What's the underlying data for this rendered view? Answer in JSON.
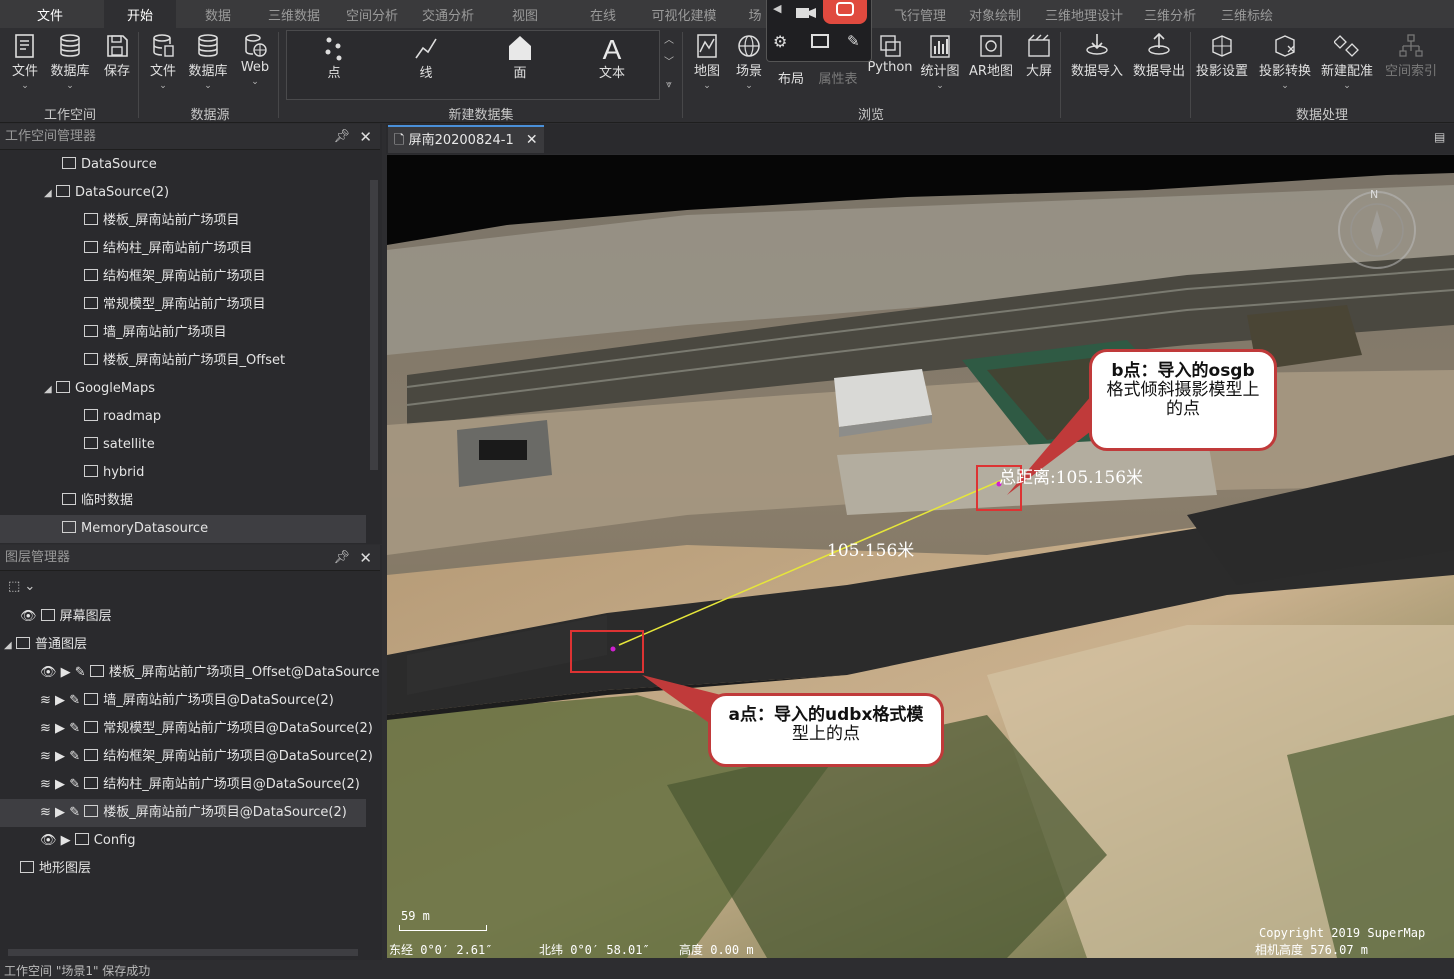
{
  "menu_tabs": [
    "文件",
    "开始",
    "数据",
    "三维数据",
    "空间分析",
    "交通分析",
    "视图",
    "在线",
    "可视化建模",
    "场",
    "飞行管理",
    "对象绘制",
    "三维地理设计",
    "三维分析",
    "三维标绘"
  ],
  "active_tab": "开始",
  "ribbon": {
    "workspace": {
      "group": "工作空间",
      "buttons": [
        "文件",
        "数据库",
        "保存"
      ]
    },
    "datasource": {
      "group": "数据源",
      "buttons": [
        "文件",
        "数据库",
        "Web"
      ]
    },
    "new_dataset": {
      "group": "新建数据集",
      "buttons": [
        "点",
        "线",
        "面",
        "文本"
      ]
    },
    "browse": {
      "group": "浏览",
      "buttons": [
        "地图",
        "场景",
        "布局",
        "属性表",
        "Python",
        "统计图",
        "AR地图",
        "大屏"
      ]
    },
    "data_processing": {
      "group": "数据处理",
      "buttons": [
        "数据导入",
        "数据导出",
        "投影设置",
        "投影转换",
        "新建配准",
        "空间索引"
      ]
    }
  },
  "workspace_panel": {
    "title": "工作空间管理器",
    "items": [
      {
        "label": "DataSource"
      },
      {
        "label": "DataSource(2)"
      },
      {
        "label": "楼板_屏南站前广场项目"
      },
      {
        "label": "结构柱_屏南站前广场项目"
      },
      {
        "label": "结构框架_屏南站前广场项目"
      },
      {
        "label": "常规模型_屏南站前广场项目"
      },
      {
        "label": "墙_屏南站前广场项目"
      },
      {
        "label": "楼板_屏南站前广场项目_Offset"
      },
      {
        "label": "GoogleMaps"
      },
      {
        "label": "roadmap"
      },
      {
        "label": "satellite"
      },
      {
        "label": "hybrid"
      },
      {
        "label": "临时数据"
      },
      {
        "label": "MemoryDatasource"
      }
    ]
  },
  "layer_panel": {
    "title": "图层管理器",
    "items": [
      {
        "label": "屏幕图层"
      },
      {
        "label": "普通图层"
      },
      {
        "label": "楼板_屏南站前广场项目_Offset@DataSource"
      },
      {
        "label": "墙_屏南站前广场项目@DataSource(2)"
      },
      {
        "label": "常规模型_屏南站前广场项目@DataSource(2)"
      },
      {
        "label": "结构框架_屏南站前广场项目@DataSource(2)"
      },
      {
        "label": "结构柱_屏南站前广场项目@DataSource(2)"
      },
      {
        "label": "楼板_屏南站前广场项目@DataSource(2)"
      },
      {
        "label": "Config"
      },
      {
        "label": "地形图层"
      }
    ]
  },
  "document_tab": "屏南20200824-1",
  "scene": {
    "distance_mid": "105.156米",
    "distance_total": "总距离:105.156米",
    "callout_b_line1": "b点：导入的osgb",
    "callout_b_line2": "格式倾斜摄影模型上",
    "callout_b_line3": "的点",
    "callout_a_line1": "a点：导入的udbx格式模",
    "callout_a_line2": "型上的点",
    "scale": "59 m",
    "lon": "东经 0°0′ 2.61″",
    "lat": "北纬 0°0′ 58.01″",
    "alt": "高度 0.00 m",
    "copyright": "Copyright 2019 SuperMap",
    "camera_alt": "相机高度 576.07 m",
    "compass": "N"
  },
  "status": "工作空间 \"场景1\" 保存成功"
}
